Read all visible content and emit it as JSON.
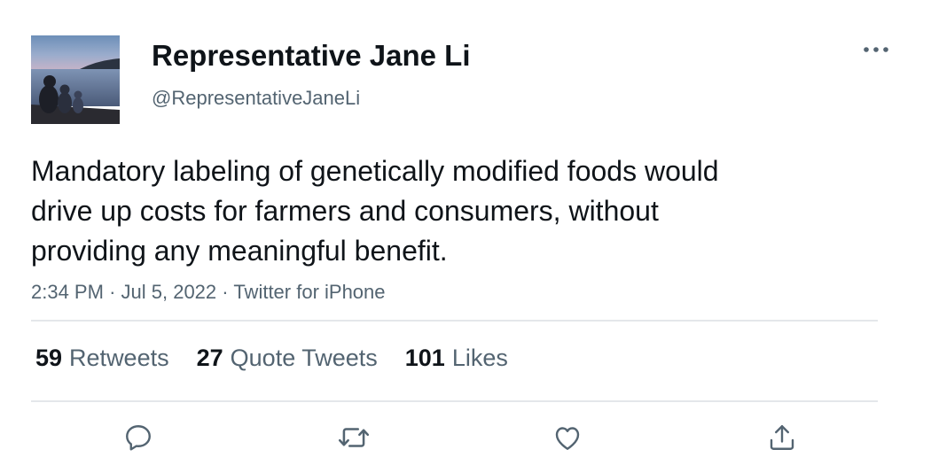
{
  "author": {
    "display_name": "Representative Jane Li",
    "handle": "@RepresentativeJaneLi",
    "avatar_icon": "family-lake-photo"
  },
  "header": {
    "more_icon": "more-horizontal-icon"
  },
  "tweet": {
    "text_lines": [
      "Mandatory labeling of genetically modified foods would",
      "drive up costs for farmers and consumers, without",
      "providing any meaningful benefit."
    ],
    "time": "2:34 PM",
    "date": "Jul 5, 2022",
    "source": "Twitter for iPhone",
    "separator": "·"
  },
  "stats": {
    "retweets": {
      "count": "59",
      "label": "Retweets"
    },
    "quote_tweets": {
      "count": "27",
      "label": "Quote Tweets"
    },
    "likes": {
      "count": "101",
      "label": "Likes"
    }
  },
  "actions": [
    {
      "icon": "reply-icon"
    },
    {
      "icon": "retweet-icon"
    },
    {
      "icon": "like-icon"
    },
    {
      "icon": "share-icon"
    }
  ],
  "colors": {
    "text_primary": "#0f1419",
    "text_secondary": "#536471",
    "divider": "#e4e7ea"
  }
}
